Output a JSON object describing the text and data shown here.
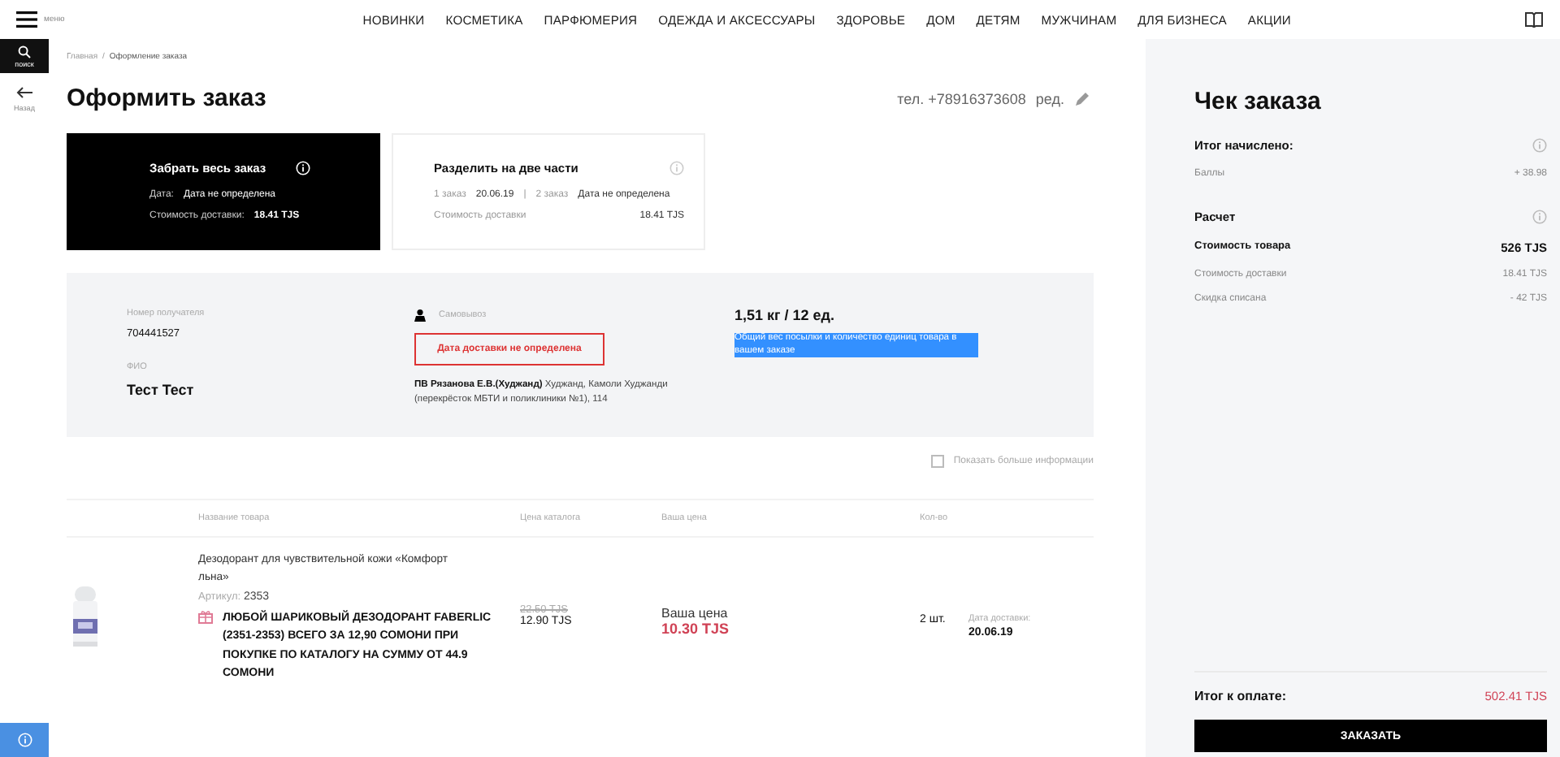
{
  "nav": {
    "menu_label": "меню",
    "items": [
      "НОВИНКИ",
      "КОСМЕТИКА",
      "ПАРФЮМЕРИЯ",
      "ОДЕЖДА И АКСЕССУАРЫ",
      "ЗДОРОВЬЕ",
      "ДОМ",
      "ДЕТЯМ",
      "МУЖЧИНАМ",
      "ДЛЯ БИЗНЕСА",
      "АКЦИИ"
    ]
  },
  "rail": {
    "search_label": "поиск",
    "back_label": "Назад"
  },
  "breadcrumbs": [
    "Главная",
    "Оформление заказа"
  ],
  "breadcrumb_separator": "/",
  "title": "Оформить заказ",
  "phone": "тел. +78916373608",
  "edit_label": "ред.",
  "delivery_options": [
    {
      "title": "Забрать весь заказ",
      "selected": true,
      "lines": [
        [
          {
            "text": "Дата:",
            "kind": "label"
          },
          {
            "text": "Дата не определена",
            "kind": "value"
          }
        ],
        [
          {
            "text": "Стоимость доставки:",
            "kind": "label"
          },
          {
            "text": "18.41 TJS",
            "kind": "value"
          }
        ]
      ]
    },
    {
      "title": "Разделить на две части",
      "selected": false,
      "lines": [
        [
          {
            "text": "1 заказ",
            "kind": "label"
          },
          {
            "text": "20.06.19",
            "kind": "value"
          },
          {
            "text": "|",
            "kind": "label"
          },
          {
            "text": "2 заказ",
            "kind": "label"
          },
          {
            "text": "Дата не определена",
            "kind": "value"
          }
        ],
        [
          {
            "text": "Стоимость доставки",
            "kind": "label"
          },
          {
            "text": "18.41 TJS",
            "kind": "value"
          }
        ]
      ]
    }
  ],
  "recipient": {
    "number_label": "Номер получателя",
    "number": "704441527",
    "name_label": "ФИО",
    "name": "Тест Тест",
    "delivery_type": "Самовывоз",
    "date_alert": "Дата доставки не определена",
    "pickup_point": "**ПВ Рязанова Е.В.(Худжанд)** Худжанд, Камоли Худжанди (перекрёсток МБТИ и поликлиники №1), 114",
    "weight": "1,51 кг / 12  ед.",
    "weight_hint": "Общий вес посылки и количество единиц товара в вашем заказе",
    "weight_hint_highlighted": true
  },
  "show_more": {
    "label": "Показать больше информации",
    "checked": false
  },
  "table": {
    "columns": [
      "Название товара",
      "Цена каталога",
      "Ваша цена",
      "Кол-во"
    ],
    "rows": [
      {
        "name": "Дезодорант для чувствительной кожи «Комфорт льна»",
        "article_label": "Артикул:",
        "article": "2353",
        "promo": "ЛЮБОЙ ШАРИКОВЫЙ ДЕЗОДОРАНТ FABERLIC (2351-2353) ВСЕГО ЗА 12,90 СОМОНИ ПРИ ПОКУПКЕ ПО КАТАЛОГУ НА СУММУ ОТ 44.9 СОМОНИ",
        "old_price": "22.50 TJS",
        "catalog_price": "12.90 TJS",
        "your_price_label": "Ваша цена",
        "your_price": "10.30 TJS",
        "quantity": "2 шт.",
        "date_label": "Дата доставки:",
        "date": "20.06.19"
      }
    ]
  },
  "check": {
    "title": "Чек заказа",
    "sections": [
      {
        "title": "Итог начислено:",
        "rows": [
          {
            "label": "Баллы",
            "value": "+ 38.98",
            "bold": false
          }
        ]
      },
      {
        "title": "Расчет",
        "rows": [
          {
            "label": "Стоимость товара",
            "value": "526 TJS",
            "bold": true
          },
          {
            "label": "Стоимость доставки",
            "value": "18.41 TJS",
            "bold": false
          },
          {
            "label": "Скидка списана",
            "value": "- 42 TJS",
            "bold": false
          }
        ]
      }
    ],
    "total_label": "Итог к оплате:",
    "total": "502.41 TJS",
    "order_button": "ЗАКАЗАТЬ"
  }
}
